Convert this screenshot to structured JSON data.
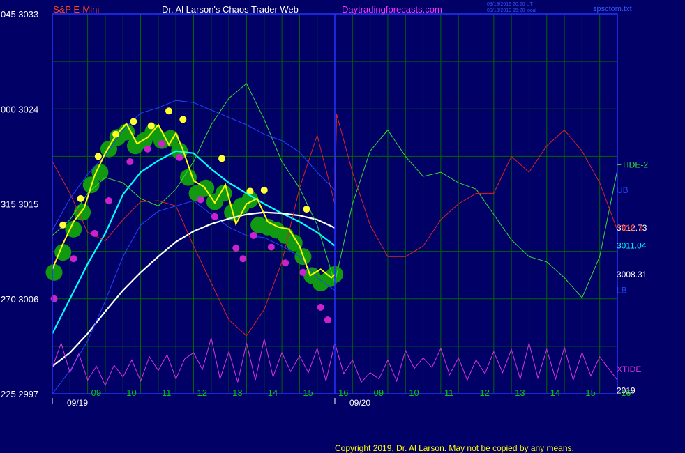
{
  "header": {
    "symbol": "S&P E-Mini",
    "site": "Dr. Al Larson's Chaos Trader Web",
    "url": "Daytradingforecasts.com",
    "stamp_utc": "09/19/2019 20:20 UT",
    "stamp_local": "09/19/2019 15:20 local",
    "file": "spsctom.txt"
  },
  "footer": {
    "copyright": "Copyright 2019, Dr. Al Larson. May not be copied by any means."
  },
  "colors": {
    "background": "#000066",
    "grid": "#006600",
    "frame": "#2233ff",
    "price": "#ffff00",
    "fast_ma": "#00ffff",
    "slow_ma": "#ffffff",
    "tide_plus": "#33dd33",
    "tide_minus": "#dd2222",
    "xtide": "#dd33dd",
    "band": "#2244ff"
  },
  "chart_data": {
    "type": "line",
    "title": "S&P E-Mini",
    "ylim": [
      2997,
      3033
    ],
    "y_ticks": [
      {
        "value": 3033,
        "label": "045  3033"
      },
      {
        "value": 3024,
        "label": "000  3024"
      },
      {
        "value": 3015,
        "label": "315  3015"
      },
      {
        "value": 3006,
        "label": "270  3006"
      },
      {
        "value": 2997,
        "label": "225  2997"
      }
    ],
    "xlim": [
      8.05,
      17.15
    ],
    "x_unit": "hour (day 09/19 = 8-16, day 09/20 = 16-17.15 continuing)",
    "x_ticks": [
      {
        "x": 9,
        "label": "09"
      },
      {
        "x": 10,
        "label": "10"
      },
      {
        "x": 11,
        "label": "11"
      },
      {
        "x": 12,
        "label": "12"
      },
      {
        "x": 13,
        "label": "13"
      },
      {
        "x": 14,
        "label": "14"
      },
      {
        "x": 15,
        "label": "15"
      },
      {
        "x": 16,
        "label": "16"
      },
      {
        "x": 17,
        "label": "09"
      },
      {
        "x": 18,
        "label": "10"
      },
      {
        "x": 19,
        "label": "11"
      },
      {
        "x": 20,
        "label": "12"
      },
      {
        "x": 21,
        "label": "13"
      },
      {
        "x": 22,
        "label": "14"
      },
      {
        "x": 23,
        "label": "15"
      },
      {
        "x": 24,
        "label": "16"
      }
    ],
    "date_labels": [
      {
        "x": 8,
        "label": "09/19"
      },
      {
        "x": 16,
        "label": "09/20"
      }
    ],
    "right_labels": [
      {
        "y": 3018.7,
        "label": "+TIDE-2",
        "color": "#33dd33"
      },
      {
        "y": 3016.3,
        "label": "UB",
        "color": "#2244ff"
      },
      {
        "y": 3012.73,
        "label": "3012.73",
        "color": "#ffffff"
      },
      {
        "y": 3012.7,
        "label": "TIDE-1",
        "color": "#dd2222"
      },
      {
        "y": 3011.04,
        "label": "3011.04",
        "color": "#00ffff"
      },
      {
        "y": 3008.31,
        "label": "3008.31",
        "color": "#ffffff"
      },
      {
        "y": 3006.8,
        "label": "LB",
        "color": "#2244ff"
      },
      {
        "y": 2999.3,
        "label": "XTIDE",
        "color": "#dd33dd"
      },
      {
        "y": 2997.3,
        "label": "2019",
        "color": "#ffffff"
      }
    ],
    "series": [
      {
        "name": "S&P E-Mini",
        "color": "#ffff00",
        "x": [
          8.0,
          8.3,
          8.6,
          8.9,
          9.2,
          9.5,
          9.8,
          10.1,
          10.4,
          10.7,
          11.0,
          11.3,
          11.5,
          11.7,
          12.0,
          12.3,
          12.6,
          12.9,
          13.2,
          13.5,
          13.8,
          14.1,
          14.4,
          14.7,
          15.0,
          15.3,
          15.6,
          15.9,
          16.0
        ],
        "values": [
          3008.8,
          3011.2,
          3013.3,
          3014.6,
          3017.7,
          3019.8,
          3021.5,
          3022.6,
          3020.7,
          3021.3,
          3022.5,
          3020.6,
          3021.7,
          3020.1,
          3017.2,
          3016.6,
          3015.1,
          3016.8,
          3013.1,
          3015.0,
          3015.5,
          3013.3,
          3012.8,
          3012.6,
          3011.0,
          3008.2,
          3008.8,
          3008.0,
          3008.31
        ]
      },
      {
        "name": "3011.04",
        "color": "#00ffff",
        "x": [
          8.0,
          8.5,
          9.0,
          9.5,
          10.0,
          10.5,
          11.0,
          11.5,
          12.0,
          12.5,
          13.0,
          13.5,
          14.0,
          14.5,
          15.0,
          15.5,
          16.0
        ],
        "values": [
          3002.7,
          3006.0,
          3009.3,
          3012.2,
          3015.9,
          3018.0,
          3019.1,
          3020.0,
          3019.8,
          3018.3,
          3017.0,
          3016.0,
          3015.0,
          3014.1,
          3013.3,
          3012.3,
          3011.04
        ]
      },
      {
        "name": "3012.73",
        "color": "#ffffff",
        "x": [
          8.0,
          8.5,
          9.0,
          9.5,
          10.0,
          10.5,
          11.0,
          11.5,
          12.0,
          12.5,
          13.0,
          13.5,
          14.0,
          14.5,
          15.0,
          15.5,
          16.0
        ],
        "values": [
          2999.6,
          3000.9,
          3002.7,
          3004.8,
          3006.8,
          3008.5,
          3010.0,
          3011.4,
          3012.4,
          3013.1,
          3013.6,
          3014.0,
          3014.2,
          3014.1,
          3013.9,
          3013.5,
          3012.73
        ]
      },
      {
        "name": "+TIDE-2",
        "color": "#33dd33",
        "x": [
          8.0,
          8.5,
          9.0,
          9.5,
          10.0,
          10.5,
          11.0,
          11.5,
          12.0,
          12.5,
          13.0,
          13.5,
          14.0,
          14.5,
          15.0,
          15.5,
          16.0,
          16.5,
          17.0,
          17.5,
          18.0,
          18.5,
          19.0,
          19.5,
          20.0,
          20.5,
          21.0,
          21.5,
          22.0,
          22.5,
          23.0,
          23.5,
          24.0
        ],
        "values": [
          3012.0,
          3013.5,
          3016.0,
          3017.5,
          3017.0,
          3015.5,
          3014.8,
          3016.4,
          3019.0,
          3022.5,
          3025.0,
          3026.4,
          3023.0,
          3019.0,
          3016.5,
          3013.0,
          3007.5,
          3015.0,
          3020.0,
          3022.0,
          3019.5,
          3017.6,
          3018.0,
          3017.0,
          3016.4,
          3014.0,
          3011.6,
          3010.0,
          3009.5,
          3008.0,
          3006.1,
          3010.0,
          3018.2
        ]
      },
      {
        "name": "TIDE-1",
        "color": "#dd2222",
        "x": [
          8.0,
          8.5,
          9.0,
          9.5,
          10.0,
          10.5,
          11.0,
          11.5,
          12.0,
          12.5,
          13.0,
          13.5,
          14.0,
          14.5,
          15.0,
          15.5,
          16.0,
          16.05,
          16.5,
          17.0,
          17.5,
          18.0,
          18.5,
          19.0,
          19.5,
          20.0,
          20.5,
          21.0,
          21.5,
          22.0,
          22.5,
          23.0,
          23.5,
          24.0
        ],
        "values": [
          3019.0,
          3016.0,
          3012.3,
          3011.5,
          3013.5,
          3015.2,
          3015.3,
          3014.8,
          3011.0,
          3007.5,
          3004.0,
          3002.5,
          3005.0,
          3009.5,
          3016.5,
          3021.5,
          3015.0,
          3023.5,
          3018.0,
          3013.0,
          3010.0,
          3010.0,
          3011.0,
          3013.5,
          3015.0,
          3016.0,
          3016.0,
          3019.5,
          3018.0,
          3020.5,
          3022.0,
          3020.0,
          3017.0,
          3012.5
        ]
      },
      {
        "name": "UB",
        "color": "#2244ff",
        "x": [
          8.0,
          8.5,
          9.0,
          9.5,
          10.0,
          10.5,
          11.0,
          11.5,
          12.0,
          12.5,
          13.0,
          13.5,
          14.0,
          14.5,
          15.0,
          15.5,
          16.0
        ],
        "values": [
          3012.5,
          3015.5,
          3017.8,
          3019.6,
          3022.0,
          3023.6,
          3024.1,
          3024.8,
          3024.6,
          3023.9,
          3023.2,
          3022.5,
          3021.6,
          3021.0,
          3019.9,
          3018.0,
          3016.3
        ]
      },
      {
        "name": "LB",
        "color": "#2244ff",
        "x": [
          8.0,
          8.5,
          9.0,
          9.5,
          10.0,
          10.5,
          11.0,
          11.5,
          12.0,
          12.5,
          13.0,
          13.5,
          14.0,
          14.5,
          15.0,
          15.5,
          16.0
        ],
        "values": [
          2997.0,
          2999.2,
          3002.0,
          3005.8,
          3010.0,
          3013.0,
          3014.3,
          3014.8,
          3015.3,
          3014.0,
          3012.8,
          3012.0,
          3011.8,
          3011.0,
          3010.0,
          3008.0,
          3006.8
        ]
      },
      {
        "name": "XTIDE",
        "color": "#dd33dd",
        "x": [
          8.0,
          8.25,
          8.5,
          8.75,
          9.0,
          9.25,
          9.5,
          9.75,
          10.0,
          10.25,
          10.5,
          10.75,
          11.0,
          11.25,
          11.5,
          11.75,
          12.0,
          12.25,
          12.5,
          12.75,
          13.0,
          13.25,
          13.5,
          13.75,
          14.0,
          14.25,
          14.5,
          14.75,
          15.0,
          15.25,
          15.5,
          15.75,
          16.0,
          16.25,
          16.5,
          16.75,
          17.0,
          17.25,
          17.5,
          17.75,
          18.0,
          18.25,
          18.5,
          18.75,
          19.0,
          19.25,
          19.5,
          19.75,
          20.0,
          20.25,
          20.5,
          20.75,
          21.0,
          21.25,
          21.5,
          21.75,
          22.0,
          22.25,
          22.5,
          22.75,
          23.0,
          23.25,
          23.5,
          23.75,
          24.0
        ],
        "values": [
          2999.5,
          3001.8,
          2999.0,
          3000.8,
          2998.3,
          2999.6,
          2997.8,
          2999.7,
          2998.6,
          3000.2,
          2998.2,
          3000.5,
          2999.2,
          3000.7,
          2998.4,
          3000.3,
          3000.9,
          2999.3,
          3002.3,
          2998.4,
          3001.0,
          2998.1,
          3001.8,
          2998.3,
          3002.2,
          2998.6,
          3000.9,
          2999.1,
          3000.6,
          2999.0,
          3001.3,
          2998.2,
          3001.8,
          2998.9,
          3000.2,
          2998.1,
          2999.0,
          2998.4,
          3000.2,
          2998.2,
          3001.1,
          2999.4,
          3000.4,
          2999.5,
          3001.3,
          2998.8,
          3000.4,
          2998.3,
          3000.2,
          2998.9,
          3001.0,
          2999.0,
          3001.2,
          2998.4,
          3001.8,
          2998.5,
          3001.2,
          2998.4,
          3001.4,
          2998.3,
          3000.9,
          2998.7,
          3000.5,
          2999.4,
          2998.3
        ]
      }
    ],
    "signals": {
      "green_x": [
        8.05,
        8.3,
        8.6,
        8.85,
        9.1,
        9.35,
        9.6,
        9.85,
        10.1,
        10.35,
        10.6,
        10.85,
        11.1,
        11.35,
        11.6,
        11.85,
        12.1,
        12.35,
        12.6,
        12.85,
        13.1,
        13.35,
        13.6,
        13.85,
        14.1,
        14.35,
        14.6,
        14.85,
        15.1,
        15.35,
        15.6,
        15.85,
        16.0
      ],
      "green_values": [
        3008.5,
        3010.4,
        3012.6,
        3014.2,
        3016.8,
        3018.0,
        3020.2,
        3021.3,
        3021.8,
        3020.5,
        3021.0,
        3021.8,
        3021.0,
        3021.2,
        3020.0,
        3017.5,
        3016.0,
        3016.5,
        3015.2,
        3016.0,
        3014.2,
        3014.8,
        3015.4,
        3013.0,
        3012.8,
        3012.5,
        3012.0,
        3011.3,
        3010.0,
        3008.2,
        3007.5,
        3007.9,
        3008.31
      ],
      "yellow_x": [
        8.3,
        8.8,
        9.3,
        9.8,
        10.3,
        10.8,
        11.3,
        11.7,
        12.8,
        13.6,
        14.0,
        15.2
      ],
      "yellow_values": [
        3013.0,
        3015.5,
        3019.5,
        3021.6,
        3022.8,
        3022.4,
        3023.8,
        3023.0,
        3019.3,
        3016.2,
        3016.3,
        3014.5
      ],
      "magenta_x": [
        8.05,
        8.6,
        9.2,
        9.6,
        10.2,
        10.7,
        11.1,
        11.6,
        12.2,
        12.6,
        13.2,
        13.4,
        13.7,
        14.2,
        14.6,
        15.1,
        15.6,
        15.8
      ],
      "magenta_values": [
        3006.0,
        3009.8,
        3012.2,
        3015.3,
        3019.0,
        3020.2,
        3020.7,
        3019.4,
        3015.4,
        3013.8,
        3010.8,
        3009.8,
        3012.0,
        3010.9,
        3009.4,
        3008.5,
        3005.2,
        3004.0
      ]
    }
  }
}
